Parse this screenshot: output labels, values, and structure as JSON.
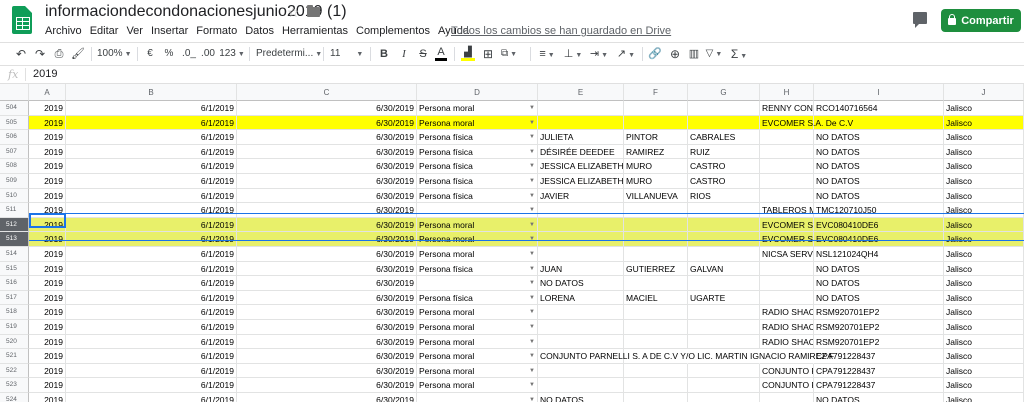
{
  "header": {
    "doc_title": "informaciondecondonacionesjunio2019 (1)",
    "menu": [
      "Archivo",
      "Editar",
      "Ver",
      "Insertar",
      "Formato",
      "Datos",
      "Herramientas",
      "Complementos",
      "Ayuda"
    ],
    "saved_status": "Todos los cambios se han guardado en Drive",
    "share_label": "Compartir"
  },
  "toolbar": {
    "zoom": "100%",
    "currency": "€",
    "percent": "%",
    "dec_less": ".0_",
    "dec_more": ".00",
    "more_formats": "123",
    "font": "Predetermi...",
    "font_size": "11",
    "bold": "B",
    "italic": "I",
    "strike": "S",
    "text_color": "A"
  },
  "formula_bar": {
    "fx": "fx",
    "value": "2019"
  },
  "columns": [
    "A",
    "B",
    "C",
    "D",
    "E",
    "F",
    "G",
    "H",
    "I",
    "J"
  ],
  "rows": [
    {
      "n": "504",
      "a": "2019",
      "b": "6/1/2019",
      "c": "6/30/2019",
      "d": "Persona moral",
      "e": "",
      "f": "",
      "g": "",
      "h": "RENNY CONC",
      "i": "RCO140716564",
      "j": "Jalisco",
      "style": ""
    },
    {
      "n": "505",
      "a": "2019",
      "b": "6/1/2019",
      "c": "6/30/2019",
      "d": "Persona moral",
      "e": "",
      "f": "",
      "g": "",
      "h": "EVCOMER S.A. De C.V",
      "i": "",
      "j": "Jalisco",
      "style": "yellow"
    },
    {
      "n": "506",
      "a": "2019",
      "b": "6/1/2019",
      "c": "6/30/2019",
      "d": "Persona física",
      "e": "JULIETA",
      "f": "PINTOR",
      "g": "CABRALES",
      "h": "",
      "i": "NO DATOS",
      "j": "Jalisco",
      "style": ""
    },
    {
      "n": "507",
      "a": "2019",
      "b": "6/1/2019",
      "c": "6/30/2019",
      "d": "Persona física",
      "e": "DÉSIRÉE DEEDEE",
      "f": "RAMIREZ",
      "g": "RUIZ",
      "h": "",
      "i": "NO DATOS",
      "j": "Jalisco",
      "style": ""
    },
    {
      "n": "508",
      "a": "2019",
      "b": "6/1/2019",
      "c": "6/30/2019",
      "d": "Persona física",
      "e": "JESSICA ELIZABETH",
      "f": "MURO",
      "g": "CASTRO",
      "h": "",
      "i": "NO DATOS",
      "j": "Jalisco",
      "style": ""
    },
    {
      "n": "509",
      "a": "2019",
      "b": "6/1/2019",
      "c": "6/30/2019",
      "d": "Persona física",
      "e": "JESSICA ELIZABETH",
      "f": "MURO",
      "g": "CASTRO",
      "h": "",
      "i": "NO DATOS",
      "j": "Jalisco",
      "style": ""
    },
    {
      "n": "510",
      "a": "2019",
      "b": "6/1/2019",
      "c": "6/30/2019",
      "d": "Persona física",
      "e": "JAVIER",
      "f": "VILLANUEVA",
      "g": "RIOS",
      "h": "",
      "i": "NO DATOS",
      "j": "Jalisco",
      "style": ""
    },
    {
      "n": "511",
      "a": "2019",
      "b": "6/1/2019",
      "c": "6/30/2019",
      "d": "",
      "e": "",
      "f": "",
      "g": "",
      "h": "TABLEROS MA",
      "i": "TMC120710J50",
      "j": "Jalisco",
      "style": ""
    },
    {
      "n": "512",
      "a": "2019",
      "b": "6/1/2019",
      "c": "6/30/2019",
      "d": "Persona moral",
      "e": "",
      "f": "",
      "g": "",
      "h": "EVCOMER S.A",
      "i": "EVC080410DE6",
      "j": "Jalisco",
      "style": "sel"
    },
    {
      "n": "513",
      "a": "2019",
      "b": "6/1/2019",
      "c": "6/30/2019",
      "d": "Persona moral",
      "e": "",
      "f": "",
      "g": "",
      "h": "EVCOMER S.A",
      "i": "EVC080410DE6",
      "j": "Jalisco",
      "style": "sel"
    },
    {
      "n": "514",
      "a": "2019",
      "b": "6/1/2019",
      "c": "6/30/2019",
      "d": "Persona moral",
      "e": "",
      "f": "",
      "g": "",
      "h": "NICSA SERVIC",
      "i": "NSL121024QH4",
      "j": "Jalisco",
      "style": ""
    },
    {
      "n": "515",
      "a": "2019",
      "b": "6/1/2019",
      "c": "6/30/2019",
      "d": "Persona física",
      "e": "JUAN",
      "f": "GUTIERREZ",
      "g": "GALVAN",
      "h": "",
      "i": "NO DATOS",
      "j": "Jalisco",
      "style": ""
    },
    {
      "n": "516",
      "a": "2019",
      "b": "6/1/2019",
      "c": "6/30/2019",
      "d": "",
      "e": "NO DATOS",
      "f": "",
      "g": "",
      "h": "",
      "i": "NO DATOS",
      "j": "Jalisco",
      "style": ""
    },
    {
      "n": "517",
      "a": "2019",
      "b": "6/1/2019",
      "c": "6/30/2019",
      "d": "Persona física",
      "e": "LORENA",
      "f": "MACIEL",
      "g": "UGARTE",
      "h": "",
      "i": "NO DATOS",
      "j": "Jalisco",
      "style": ""
    },
    {
      "n": "518",
      "a": "2019",
      "b": "6/1/2019",
      "c": "6/30/2019",
      "d": "Persona moral",
      "e": "",
      "f": "",
      "g": "",
      "h": "RADIO SHACK",
      "i": "RSM920701EP2",
      "j": "Jalisco",
      "style": ""
    },
    {
      "n": "519",
      "a": "2019",
      "b": "6/1/2019",
      "c": "6/30/2019",
      "d": "Persona moral",
      "e": "",
      "f": "",
      "g": "",
      "h": "RADIO SHACK",
      "i": "RSM920701EP2",
      "j": "Jalisco",
      "style": ""
    },
    {
      "n": "520",
      "a": "2019",
      "b": "6/1/2019",
      "c": "6/30/2019",
      "d": "Persona moral",
      "e": "",
      "f": "",
      "g": "",
      "h": "RADIO SHACK",
      "i": "RSM920701EP2",
      "j": "Jalisco",
      "style": ""
    },
    {
      "n": "521",
      "a": "2019",
      "b": "6/1/2019",
      "c": "6/30/2019",
      "d": "Persona moral",
      "e": "CONJUNTO PARNELLI S. A DE C.V Y/O LIC. MARTIN IGNACIO RAMIREZ F",
      "f": "",
      "g": "",
      "h": "",
      "i": "CPA791228437",
      "j": "Jalisco",
      "style": ""
    },
    {
      "n": "522",
      "a": "2019",
      "b": "6/1/2019",
      "c": "6/30/2019",
      "d": "Persona moral",
      "e": "",
      "f": "",
      "g": "",
      "h": "CONJUNTO P",
      "i": "CPA791228437",
      "j": "Jalisco",
      "style": ""
    },
    {
      "n": "523",
      "a": "2019",
      "b": "6/1/2019",
      "c": "6/30/2019",
      "d": "Persona moral",
      "e": "",
      "f": "",
      "g": "",
      "h": "CONJUNTO P",
      "i": "CPA791228437",
      "j": "Jalisco",
      "style": ""
    },
    {
      "n": "524",
      "a": "2019",
      "b": "6/1/2019",
      "c": "6/30/2019",
      "d": "",
      "e": "NO DATOS",
      "f": "",
      "g": "",
      "h": "",
      "i": "NO DATOS",
      "j": "Jalisco",
      "style": ""
    }
  ]
}
